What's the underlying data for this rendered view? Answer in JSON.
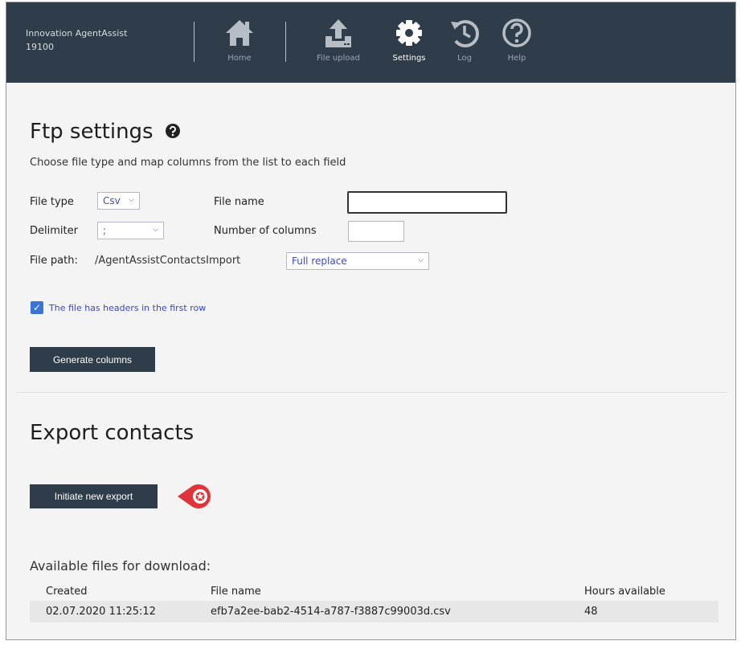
{
  "app": {
    "name": "Innovation AgentAssist",
    "id": "19100"
  },
  "nav": [
    {
      "key": "home",
      "label": "Home",
      "icon": "home-icon"
    },
    {
      "key": "file_upload",
      "label": "File upload",
      "icon": "upload-icon"
    },
    {
      "key": "settings",
      "label": "Settings",
      "icon": "gear-icon",
      "active": true
    },
    {
      "key": "log",
      "label": "Log",
      "icon": "history-icon"
    },
    {
      "key": "help",
      "label": "Help",
      "icon": "help-icon"
    }
  ],
  "ftp": {
    "title": "Ftp settings",
    "subtitle": "Choose file type and map columns from the list to each field",
    "file_type_label": "File type",
    "file_type_value": "Csv",
    "delimiter_label": "Delimiter",
    "delimiter_value": ";",
    "file_name_label": "File name",
    "file_name_value": "",
    "num_columns_label": "Number of columns",
    "num_columns_value": "",
    "file_path_label": "File path:",
    "file_path_value": "/AgentAssistContactsImport",
    "import_mode_value": "Full replace",
    "headers_checkbox_label": "The file has headers in the first row",
    "headers_checked": true,
    "generate_button": "Generate columns"
  },
  "export": {
    "title": "Export contacts",
    "initiate_button": "Initiate new export",
    "available_label": "Available files for download:",
    "columns": [
      "Created",
      "File name",
      "Hours available"
    ],
    "rows": [
      {
        "created": "02.07.2020 11:25:12",
        "file_name": "efb7a2ee-bab2-4514-a787-f3887c99003d.csv",
        "hours": "48"
      }
    ]
  },
  "colors": {
    "topbar": "#2f3d4a",
    "accent": "#3a74d6",
    "marker": "#e0333a"
  }
}
